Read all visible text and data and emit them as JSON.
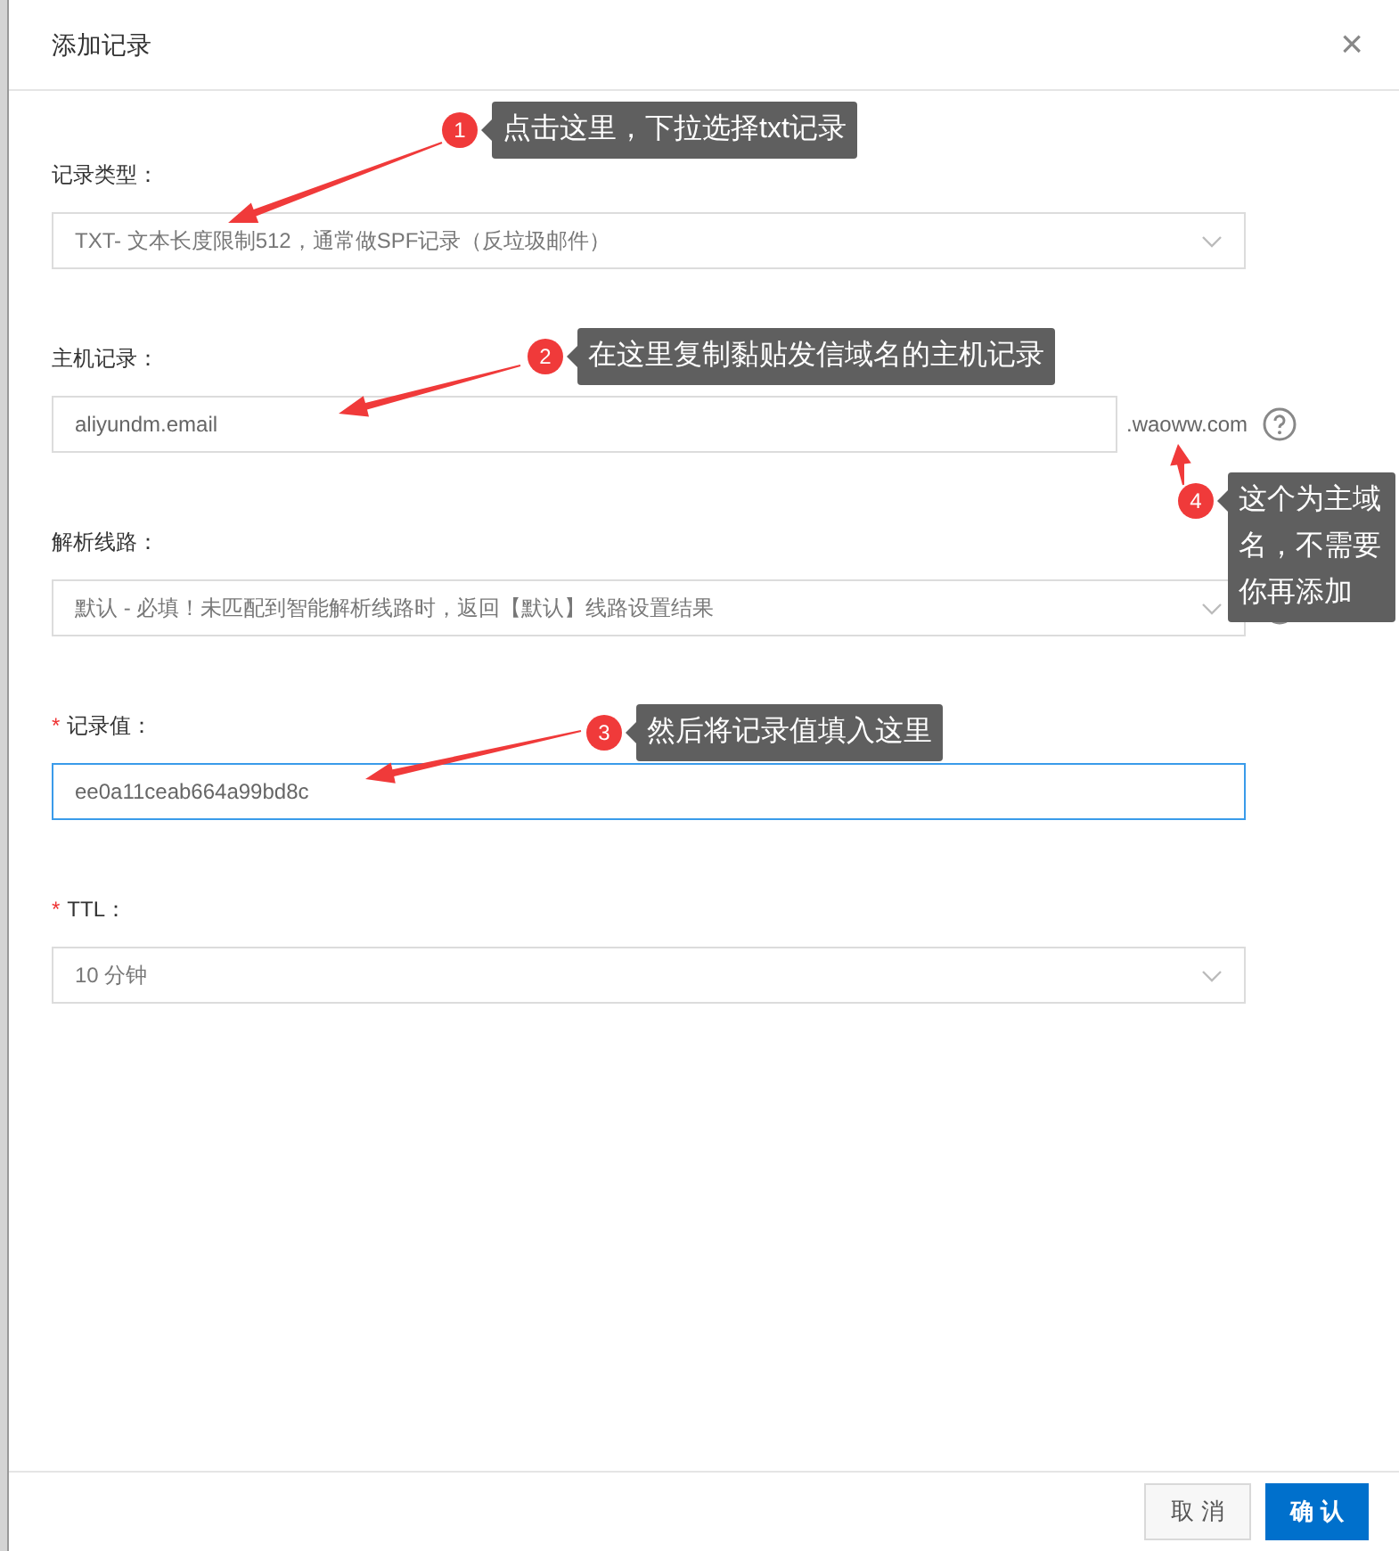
{
  "dialog": {
    "title": "添加记录",
    "close": "×"
  },
  "fields": [
    {
      "kind": "select",
      "label": "记录类型：",
      "value": "TXT- 文本长度限制512，通常做SPF记录（反垃圾邮件）",
      "focused": false,
      "help": false
    },
    {
      "kind": "input",
      "label": "主机记录：",
      "value": "aliyundm.email",
      "suffix": ".waoww.com",
      "focused": false,
      "help": true
    },
    {
      "kind": "select",
      "label": "解析线路：",
      "value": "默认 - 必填！未匹配到智能解析线路时，返回【默认】线路设置结果",
      "focused": false,
      "help": true
    },
    {
      "kind": "input",
      "label": "记录值：",
      "required_mark": "*",
      "value": "ee0a11ceab664a99bd8c",
      "focused": true,
      "help": false
    },
    {
      "kind": "select",
      "label": "TTL：",
      "required_mark": "*",
      "value": "10 分钟",
      "focused": false,
      "help": false
    }
  ],
  "annotations": [
    {
      "number": "1",
      "text": "点击这里，下拉选择txt记录"
    },
    {
      "number": "2",
      "text": "在这里复制黏贴发信域名的主机记录"
    },
    {
      "number": "3",
      "text": "然后将记录值填入这里"
    },
    {
      "number": "4",
      "text": "这个为主域名，不需要你再添加"
    }
  ],
  "buttons": [
    {
      "label": "取 消",
      "kind": "secondary"
    },
    {
      "label": "确 认",
      "kind": "primary"
    }
  ]
}
